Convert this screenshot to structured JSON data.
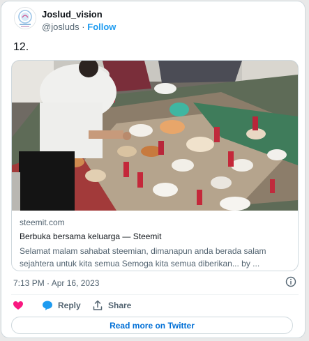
{
  "author": {
    "display_name": "Joslud_vision",
    "handle": "@josluds",
    "separator": "·",
    "follow_label": "Follow"
  },
  "tweet": {
    "text": "12."
  },
  "link_card": {
    "domain": "steemit.com",
    "title": "Berbuka bersama keluarga — Steemit",
    "description": "Selamat malam sahabat steemian, dimanapun anda berada salam sejahtera untuk kita semua Semoga kita semua diberikan... by ..."
  },
  "meta": {
    "timestamp": "7:13 PM · Apr 16, 2023",
    "info_icon": "info-icon"
  },
  "actions": {
    "like_icon": "heart-icon",
    "reply_label": "Reply",
    "reply_icon": "reply-bubble-icon",
    "share_label": "Share",
    "share_icon": "share-upload-icon"
  },
  "read_more": {
    "label": "Read more on Twitter"
  },
  "colors": {
    "accent": "#1d9bf0",
    "like": "#f91880",
    "read_more": "#006fd6",
    "muted": "#536471"
  }
}
